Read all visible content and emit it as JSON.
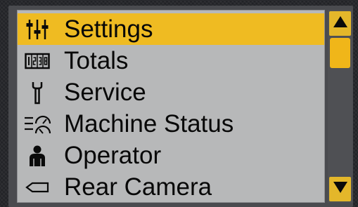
{
  "menu": {
    "items": [
      {
        "label": "Settings",
        "icon": "settings-sliders-icon",
        "selected": true
      },
      {
        "label": "Totals",
        "icon": "totals-counter-icon",
        "selected": false
      },
      {
        "label": "Service",
        "icon": "wrench-icon",
        "selected": false
      },
      {
        "label": "Machine Status",
        "icon": "machine-status-gauge-icon",
        "selected": false
      },
      {
        "label": "Operator",
        "icon": "operator-person-icon",
        "selected": false
      },
      {
        "label": "Rear Camera",
        "icon": "rear-camera-icon",
        "selected": false
      }
    ]
  },
  "scrollbar": {
    "up_icon": "arrow-up-icon",
    "down_icon": "arrow-down-icon",
    "position": 0
  },
  "colors": {
    "highlight": "#efbb22",
    "panel": "#b7b8b9",
    "scroll_accent": "#e4b72a",
    "text": "#080808"
  }
}
